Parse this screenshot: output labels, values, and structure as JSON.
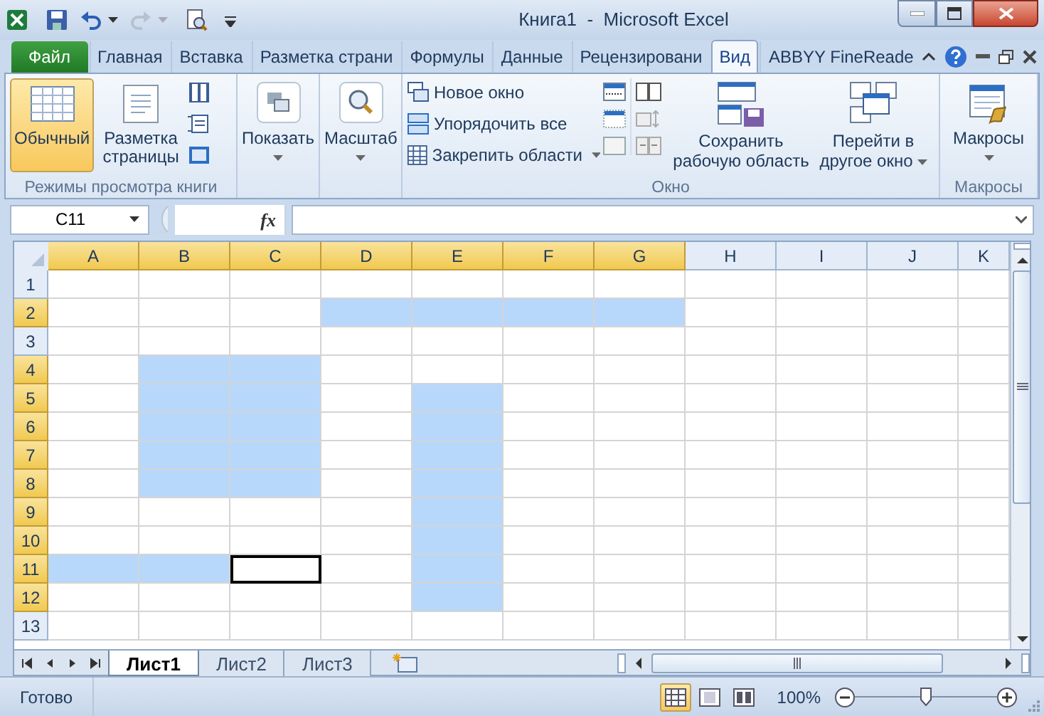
{
  "window": {
    "title": "Книга1  -  Microsoft Excel"
  },
  "tabs": [
    {
      "label": "Файл",
      "kind": "file",
      "selected": false
    },
    {
      "label": "Главная",
      "kind": "tab",
      "selected": false
    },
    {
      "label": "Вставка",
      "kind": "tab",
      "selected": false
    },
    {
      "label": "Разметка страни",
      "kind": "tab",
      "selected": false
    },
    {
      "label": "Формулы",
      "kind": "tab",
      "selected": false
    },
    {
      "label": "Данные",
      "kind": "tab",
      "selected": false
    },
    {
      "label": "Рецензировани",
      "kind": "tab",
      "selected": false
    },
    {
      "label": "Вид",
      "kind": "tab",
      "selected": true
    },
    {
      "label": "ABBYY FineReade",
      "kind": "tab",
      "selected": false
    }
  ],
  "ribbon": {
    "views": {
      "label": "Режимы просмотра книги",
      "buttons": [
        {
          "label": "Обычный",
          "selected": true
        },
        {
          "label": "Разметка страницы",
          "selected": false
        }
      ]
    },
    "show": {
      "label": "Показать"
    },
    "zoom": {
      "label": "Масштаб"
    },
    "window_group": {
      "label": "Окно",
      "items": [
        {
          "label": "Новое окно",
          "dropdown": false
        },
        {
          "label": "Упорядочить все",
          "dropdown": false
        },
        {
          "label": "Закрепить области",
          "dropdown": true
        }
      ],
      "save_workspace": "Сохранить рабочую область",
      "switch_windows": "Перейти в другое окно"
    },
    "macros": {
      "button": "Макросы",
      "label": "Макросы"
    }
  },
  "formula_bar": {
    "name_box": "C11",
    "fx": "fx"
  },
  "grid": {
    "columns": [
      {
        "label": "A",
        "selected": true
      },
      {
        "label": "B",
        "selected": true
      },
      {
        "label": "C",
        "selected": true
      },
      {
        "label": "D",
        "selected": true
      },
      {
        "label": "E",
        "selected": true
      },
      {
        "label": "F",
        "selected": true
      },
      {
        "label": "G",
        "selected": true
      },
      {
        "label": "H",
        "selected": false
      },
      {
        "label": "I",
        "selected": false
      },
      {
        "label": "J",
        "selected": false
      },
      {
        "label": "K",
        "selected": false
      }
    ],
    "rows": [
      {
        "label": "1",
        "selected": false,
        "cells": [
          {
            "selected": false,
            "active": false
          },
          {
            "selected": false,
            "active": false
          },
          {
            "selected": false,
            "active": false
          },
          {
            "selected": false,
            "active": false
          },
          {
            "selected": false,
            "active": false
          },
          {
            "selected": false,
            "active": false
          },
          {
            "selected": false,
            "active": false
          },
          {
            "selected": false,
            "active": false
          },
          {
            "selected": false,
            "active": false
          },
          {
            "selected": false,
            "active": false
          },
          {
            "selected": false,
            "active": false
          }
        ]
      },
      {
        "label": "2",
        "selected": true,
        "cells": [
          {
            "selected": false,
            "active": false
          },
          {
            "selected": false,
            "active": false
          },
          {
            "selected": false,
            "active": false
          },
          {
            "selected": true,
            "active": false
          },
          {
            "selected": true,
            "active": false
          },
          {
            "selected": true,
            "active": false
          },
          {
            "selected": true,
            "active": false
          },
          {
            "selected": false,
            "active": false
          },
          {
            "selected": false,
            "active": false
          },
          {
            "selected": false,
            "active": false
          },
          {
            "selected": false,
            "active": false
          }
        ]
      },
      {
        "label": "3",
        "selected": false,
        "cells": [
          {
            "selected": false,
            "active": false
          },
          {
            "selected": false,
            "active": false
          },
          {
            "selected": false,
            "active": false
          },
          {
            "selected": false,
            "active": false
          },
          {
            "selected": false,
            "active": false
          },
          {
            "selected": false,
            "active": false
          },
          {
            "selected": false,
            "active": false
          },
          {
            "selected": false,
            "active": false
          },
          {
            "selected": false,
            "active": false
          },
          {
            "selected": false,
            "active": false
          },
          {
            "selected": false,
            "active": false
          }
        ]
      },
      {
        "label": "4",
        "selected": true,
        "cells": [
          {
            "selected": false,
            "active": false
          },
          {
            "selected": true,
            "active": false
          },
          {
            "selected": true,
            "active": false
          },
          {
            "selected": false,
            "active": false
          },
          {
            "selected": false,
            "active": false
          },
          {
            "selected": false,
            "active": false
          },
          {
            "selected": false,
            "active": false
          },
          {
            "selected": false,
            "active": false
          },
          {
            "selected": false,
            "active": false
          },
          {
            "selected": false,
            "active": false
          },
          {
            "selected": false,
            "active": false
          }
        ]
      },
      {
        "label": "5",
        "selected": true,
        "cells": [
          {
            "selected": false,
            "active": false
          },
          {
            "selected": true,
            "active": false
          },
          {
            "selected": true,
            "active": false
          },
          {
            "selected": false,
            "active": false
          },
          {
            "selected": true,
            "active": false
          },
          {
            "selected": false,
            "active": false
          },
          {
            "selected": false,
            "active": false
          },
          {
            "selected": false,
            "active": false
          },
          {
            "selected": false,
            "active": false
          },
          {
            "selected": false,
            "active": false
          },
          {
            "selected": false,
            "active": false
          }
        ]
      },
      {
        "label": "6",
        "selected": true,
        "cells": [
          {
            "selected": false,
            "active": false
          },
          {
            "selected": true,
            "active": false
          },
          {
            "selected": true,
            "active": false
          },
          {
            "selected": false,
            "active": false
          },
          {
            "selected": true,
            "active": false
          },
          {
            "selected": false,
            "active": false
          },
          {
            "selected": false,
            "active": false
          },
          {
            "selected": false,
            "active": false
          },
          {
            "selected": false,
            "active": false
          },
          {
            "selected": false,
            "active": false
          },
          {
            "selected": false,
            "active": false
          }
        ]
      },
      {
        "label": "7",
        "selected": true,
        "cells": [
          {
            "selected": false,
            "active": false
          },
          {
            "selected": true,
            "active": false
          },
          {
            "selected": true,
            "active": false
          },
          {
            "selected": false,
            "active": false
          },
          {
            "selected": true,
            "active": false
          },
          {
            "selected": false,
            "active": false
          },
          {
            "selected": false,
            "active": false
          },
          {
            "selected": false,
            "active": false
          },
          {
            "selected": false,
            "active": false
          },
          {
            "selected": false,
            "active": false
          },
          {
            "selected": false,
            "active": false
          }
        ]
      },
      {
        "label": "8",
        "selected": true,
        "cells": [
          {
            "selected": false,
            "active": false
          },
          {
            "selected": true,
            "active": false
          },
          {
            "selected": true,
            "active": false
          },
          {
            "selected": false,
            "active": false
          },
          {
            "selected": true,
            "active": false
          },
          {
            "selected": false,
            "active": false
          },
          {
            "selected": false,
            "active": false
          },
          {
            "selected": false,
            "active": false
          },
          {
            "selected": false,
            "active": false
          },
          {
            "selected": false,
            "active": false
          },
          {
            "selected": false,
            "active": false
          }
        ]
      },
      {
        "label": "9",
        "selected": true,
        "cells": [
          {
            "selected": false,
            "active": false
          },
          {
            "selected": false,
            "active": false
          },
          {
            "selected": false,
            "active": false
          },
          {
            "selected": false,
            "active": false
          },
          {
            "selected": true,
            "active": false
          },
          {
            "selected": false,
            "active": false
          },
          {
            "selected": false,
            "active": false
          },
          {
            "selected": false,
            "active": false
          },
          {
            "selected": false,
            "active": false
          },
          {
            "selected": false,
            "active": false
          },
          {
            "selected": false,
            "active": false
          }
        ]
      },
      {
        "label": "10",
        "selected": true,
        "cells": [
          {
            "selected": false,
            "active": false
          },
          {
            "selected": false,
            "active": false
          },
          {
            "selected": false,
            "active": false
          },
          {
            "selected": false,
            "active": false
          },
          {
            "selected": true,
            "active": false
          },
          {
            "selected": false,
            "active": false
          },
          {
            "selected": false,
            "active": false
          },
          {
            "selected": false,
            "active": false
          },
          {
            "selected": false,
            "active": false
          },
          {
            "selected": false,
            "active": false
          },
          {
            "selected": false,
            "active": false
          }
        ]
      },
      {
        "label": "11",
        "selected": true,
        "cells": [
          {
            "selected": true,
            "active": false
          },
          {
            "selected": true,
            "active": false
          },
          {
            "selected": true,
            "active": true
          },
          {
            "selected": false,
            "active": false
          },
          {
            "selected": true,
            "active": false
          },
          {
            "selected": false,
            "active": false
          },
          {
            "selected": false,
            "active": false
          },
          {
            "selected": false,
            "active": false
          },
          {
            "selected": false,
            "active": false
          },
          {
            "selected": false,
            "active": false
          },
          {
            "selected": false,
            "active": false
          }
        ]
      },
      {
        "label": "12",
        "selected": true,
        "cells": [
          {
            "selected": false,
            "active": false
          },
          {
            "selected": false,
            "active": false
          },
          {
            "selected": false,
            "active": false
          },
          {
            "selected": false,
            "active": false
          },
          {
            "selected": true,
            "active": false
          },
          {
            "selected": false,
            "active": false
          },
          {
            "selected": false,
            "active": false
          },
          {
            "selected": false,
            "active": false
          },
          {
            "selected": false,
            "active": false
          },
          {
            "selected": false,
            "active": false
          },
          {
            "selected": false,
            "active": false
          }
        ]
      },
      {
        "label": "13",
        "selected": false,
        "cells": [
          {
            "selected": false,
            "active": false
          },
          {
            "selected": false,
            "active": false
          },
          {
            "selected": false,
            "active": false
          },
          {
            "selected": false,
            "active": false
          },
          {
            "selected": false,
            "active": false
          },
          {
            "selected": false,
            "active": false
          },
          {
            "selected": false,
            "active": false
          },
          {
            "selected": false,
            "active": false
          },
          {
            "selected": false,
            "active": false
          },
          {
            "selected": false,
            "active": false
          },
          {
            "selected": false,
            "active": false
          }
        ]
      }
    ]
  },
  "sheet_tabs": [
    {
      "label": "Лист1",
      "selected": true
    },
    {
      "label": "Лист2",
      "selected": false
    },
    {
      "label": "Лист3",
      "selected": false
    }
  ],
  "status_bar": {
    "status": "Готово",
    "views": [
      {
        "kind": "normal",
        "selected": true
      },
      {
        "kind": "layout",
        "selected": false
      },
      {
        "kind": "pagebreak",
        "selected": false
      }
    ],
    "zoom": "100%",
    "zoom_slider": {
      "level": 0.5
    }
  }
}
